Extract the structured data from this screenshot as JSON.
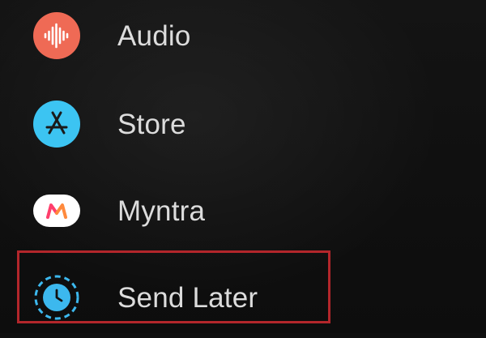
{
  "menu": {
    "items": [
      {
        "label": "Audio",
        "icon": "audio-waveform-icon",
        "color": "#ef6a55"
      },
      {
        "label": "Store",
        "icon": "app-store-icon",
        "color": "#3cc4f2"
      },
      {
        "label": "Myntra",
        "icon": "myntra-logo-icon",
        "color": "#ffffff"
      },
      {
        "label": "Send Later",
        "icon": "clock-icon",
        "color": "#3cb8ee"
      }
    ]
  },
  "highlight": {
    "target": "Send Later",
    "color": "#b3262b"
  }
}
